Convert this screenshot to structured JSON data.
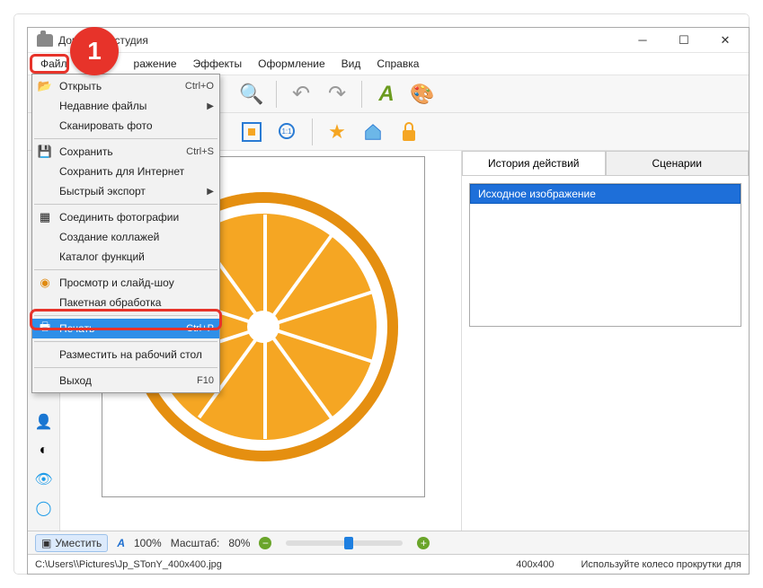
{
  "window": {
    "title": "Домашняя        студия"
  },
  "step_badge": "1",
  "menubar": {
    "file": "Файл",
    "image_hidden": "ражение",
    "effects": "Эффекты",
    "design": "Оформление",
    "view": "Вид",
    "help": "Справка"
  },
  "dropdown": {
    "open": "Открыть",
    "open_sc": "Ctrl+O",
    "recent": "Недавние файлы",
    "scan": "Сканировать фото",
    "save": "Сохранить",
    "save_sc": "Ctrl+S",
    "save_web": "Сохранить для Интернет",
    "quick_export": "Быстрый экспорт",
    "join": "Соединить фотографии",
    "collage": "Создание коллажей",
    "catalog": "Каталог функций",
    "slideshow": "Просмотр и слайд-шоу",
    "batch": "Пакетная обработка",
    "print": "Печать",
    "print_sc": "Ctrl+P",
    "desktop": "Разместить на рабочий стол",
    "exit": "Выход",
    "exit_sc": "F10"
  },
  "right": {
    "tab_history": "История действий",
    "tab_scenarios": "Сценарии",
    "history_item": "Исходное изображение"
  },
  "status": {
    "fit": "Уместить",
    "a100": "100%",
    "scale_label": "Масштаб:",
    "scale_value": "80%",
    "path_prefix": "C:\\Users\\",
    "path_file": "\\Pictures\\Jp_STonY_400x400.jpg",
    "dims": "400x400",
    "hint": "Используйте колесо прокрутки для"
  }
}
